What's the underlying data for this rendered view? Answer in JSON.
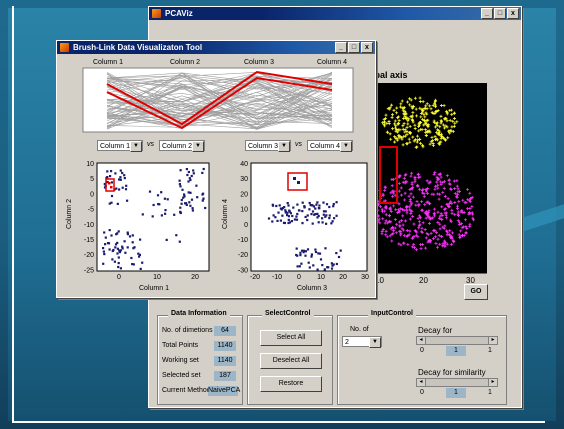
{
  "main_window": {
    "title": "PCAViz",
    "plot_title": "cipal axis",
    "go_label": "GO",
    "x_ticks": [
      "10",
      "20",
      "30"
    ],
    "window_buttons": [
      "_",
      "□",
      "x"
    ]
  },
  "brush_window": {
    "title": "Brush-Link Data Visualizaton Tool",
    "window_buttons": [
      "_",
      "□",
      "x"
    ],
    "parallel_axes": [
      "Column 1",
      "Column 2",
      "Column 3",
      "Column 4"
    ],
    "vs_label": "vs",
    "left_selectors": [
      "Column 1",
      "Column 2"
    ],
    "right_selectors": [
      "Column 3",
      "Column 4"
    ],
    "left_plot": {
      "xlabel": "Column 1",
      "ylabel": "Column 2",
      "x_ticks": [
        "0",
        "10",
        "20"
      ],
      "y_ticks": [
        "10",
        "5",
        "0",
        "-5",
        "-10",
        "-15",
        "-20",
        "-25"
      ]
    },
    "right_plot": {
      "xlabel": "Column 3",
      "ylabel": "Column 4",
      "x_ticks": [
        "-20",
        "-10",
        "0",
        "10",
        "20",
        "30"
      ],
      "y_ticks": [
        "40",
        "30",
        "20",
        "10",
        "0",
        "-10",
        "-20",
        "-30"
      ]
    }
  },
  "data_information": {
    "title": "Data Information",
    "rows": [
      {
        "label": "No. of dimetions",
        "value": "64"
      },
      {
        "label": "Total Points",
        "value": "1140"
      },
      {
        "label": "Working set",
        "value": "1140"
      },
      {
        "label": "Selected set",
        "value": "187"
      },
      {
        "label": "Current Method",
        "value": "NaivePCA"
      }
    ]
  },
  "select_control": {
    "title": "SelectControl",
    "buttons": [
      "Select All",
      "Deselect All",
      "Restore"
    ]
  },
  "input_control": {
    "title": "InputControl",
    "no_of_label": "No. of",
    "no_of_value": "2",
    "decay_label": "Decay for",
    "decay": {
      "min": "0",
      "value": "1",
      "max": "1"
    },
    "decay_sim_label": "Decay for similarity",
    "decay_sim": {
      "min": "0",
      "value": "1",
      "max": "1"
    }
  },
  "colors": {
    "matlab_title": "#0a246a",
    "selection_red": "#e00000",
    "scatter_blue": "#1a1a6e",
    "pca_yellow": "#ffff33",
    "pca_magenta": "#ff33ff"
  }
}
